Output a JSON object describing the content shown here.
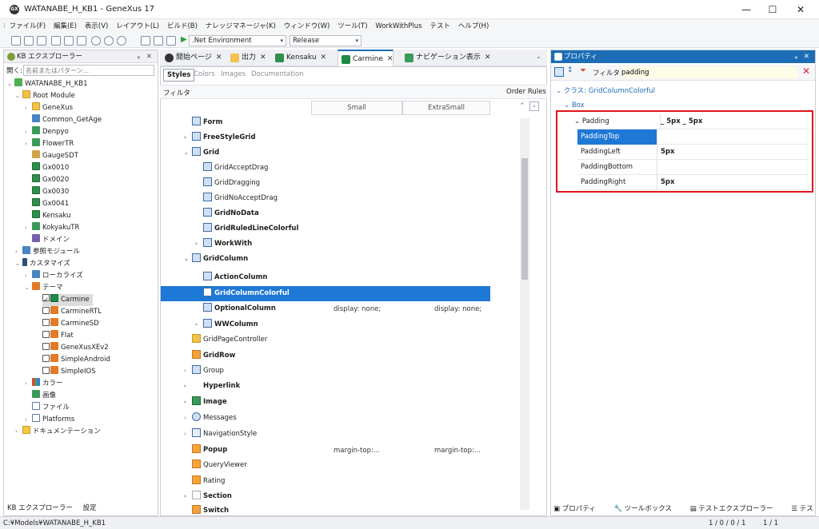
{
  "window": {
    "title": "WATANABE_H_KB1 - GeneXus 17",
    "app_icon": "GX"
  },
  "menubar": [
    "ファイル(F)",
    "編集(E)",
    "表示(V)",
    "レイアウト(L)",
    "ビルド(B)",
    "ナレッジマネージャ(K)",
    "ウィンドウ(W)",
    "ツール(T)",
    "WorkWithPlus",
    "テスト",
    "ヘルプ(H)"
  ],
  "toolbar": {
    "environment": ".Net Environment",
    "configuration": "Release"
  },
  "kb_explorer": {
    "title": "KB エクスプローラー",
    "search_label": "開く:",
    "search_placeholder": "名前またはパターン...",
    "items": [
      {
        "label": "WATANABE_H_KB1"
      },
      {
        "label": "Root Module"
      },
      {
        "label": "GeneXus"
      },
      {
        "label": "Common_GetAge"
      },
      {
        "label": "Denpyo"
      },
      {
        "label": "FlowerTR"
      },
      {
        "label": "GaugeSDT"
      },
      {
        "label": "Gx0010"
      },
      {
        "label": "Gx0020"
      },
      {
        "label": "Gx0030"
      },
      {
        "label": "Gx0041"
      },
      {
        "label": "Kensaku"
      },
      {
        "label": "KokyakuTR"
      },
      {
        "label": "ドメイン"
      },
      {
        "label": "参照モジュール"
      },
      {
        "label": "カスタマイズ"
      },
      {
        "label": "ローカライズ"
      },
      {
        "label": "テーマ"
      },
      {
        "label": "Carmine"
      },
      {
        "label": "CarmineRTL"
      },
      {
        "label": "CarmineSD"
      },
      {
        "label": "Flat"
      },
      {
        "label": "GeneXusXEv2"
      },
      {
        "label": "SimpleAndroid"
      },
      {
        "label": "SimpleIOS"
      },
      {
        "label": "カラー"
      },
      {
        "label": "画像"
      },
      {
        "label": "ファイル"
      },
      {
        "label": "Platforms"
      },
      {
        "label": "ドキュメンテーション"
      }
    ],
    "bottom_tabs": [
      "KB エクスプローラー",
      "設定"
    ]
  },
  "document_tabs": [
    {
      "label": "開始ページ"
    },
    {
      "label": "出力"
    },
    {
      "label": "Kensaku"
    },
    {
      "label": "Carmine"
    },
    {
      "label": "ナビゲーション表示"
    }
  ],
  "editor": {
    "subtabs": [
      "Styles",
      "Colors",
      "Images",
      "Documentation"
    ],
    "filter_label": "フィルタ",
    "order_rules": "Order Rules",
    "columns": [
      "Small",
      "ExtraSmall"
    ],
    "rows": [
      {
        "label": "Form"
      },
      {
        "label": "FreeStyleGrid"
      },
      {
        "label": "Grid"
      },
      {
        "label": "GridAcceptDrag"
      },
      {
        "label": "GridDragging"
      },
      {
        "label": "GridNoAcceptDrag"
      },
      {
        "label": "GridNoData"
      },
      {
        "label": "GridRuledLineColorful"
      },
      {
        "label": "WorkWith"
      },
      {
        "label": "GridColumn"
      },
      {
        "label": "ActionColumn"
      },
      {
        "label": "GridColumnColorful"
      },
      {
        "label": "OptionalColumn",
        "small": "display: none;",
        "xsmall": "display: none;"
      },
      {
        "label": "WWColumn"
      },
      {
        "label": "GridPageController"
      },
      {
        "label": "GridRow"
      },
      {
        "label": "Group"
      },
      {
        "label": "Hyperlink"
      },
      {
        "label": "Image"
      },
      {
        "label": "Messages"
      },
      {
        "label": "NavigationStyle"
      },
      {
        "label": "Popup",
        "small": "margin-top:...",
        "xsmall": "margin-top:..."
      },
      {
        "label": "QueryViewer"
      },
      {
        "label": "Rating"
      },
      {
        "label": "Section"
      },
      {
        "label": "Switch"
      }
    ]
  },
  "properties": {
    "title": "プロパティ",
    "filter_label": "フィルタ",
    "filter_value": "padding",
    "class_label": "クラス: GridColumnColorful",
    "group": "Box",
    "rows": [
      {
        "name": "Padding",
        "value": "_ 5px _ 5px"
      },
      {
        "name": "PaddingTop",
        "value": ""
      },
      {
        "name": "PaddingLeft",
        "value": "5px"
      },
      {
        "name": "PaddingBottom",
        "value": ""
      },
      {
        "name": "PaddingRight",
        "value": "5px"
      }
    ],
    "bottom_tabs": [
      "プロパティ",
      "ツールボックス",
      "テストエクスプローラー",
      "テスト結果"
    ]
  },
  "statusbar": {
    "path": "C:¥Models¥WATANABE_H_KB1",
    "counter1": "1 / 0 / 0 / 1",
    "counter2": "1 / 1"
  },
  "colors": {
    "selection": "#1e78d6",
    "highlight_border": "#e0141c",
    "accent": "#1c6db5"
  }
}
